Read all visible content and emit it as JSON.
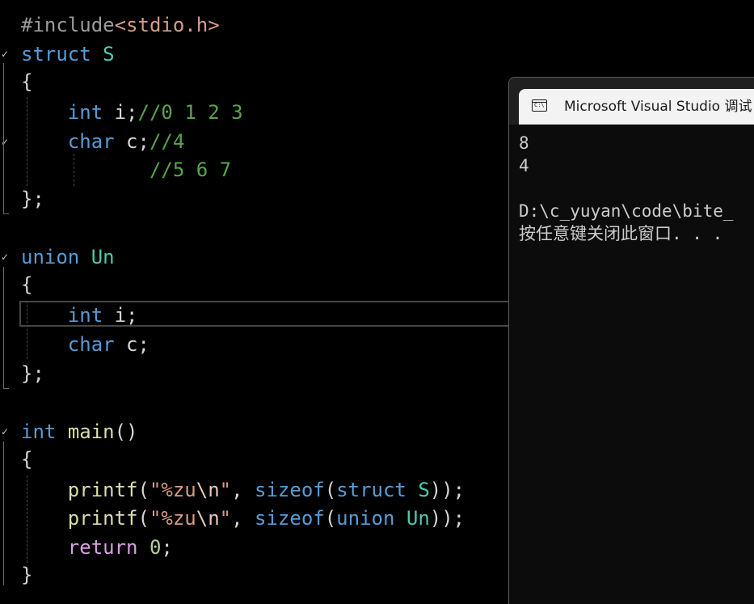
{
  "editor": {
    "lines": [
      {
        "parts": [
          [
            "pp",
            "#include"
          ],
          [
            "hd",
            "<stdio.h>"
          ]
        ]
      },
      {
        "parts": [
          [
            "kw",
            "struct"
          ],
          [
            "pu",
            " "
          ],
          [
            "ty",
            "S"
          ]
        ]
      },
      {
        "parts": [
          [
            "pu",
            "{"
          ]
        ]
      },
      {
        "parts": [
          [
            "ind",
            "    "
          ],
          [
            "kw",
            "int"
          ],
          [
            "pu",
            " i;"
          ],
          [
            "cm",
            "//0 1 2 3"
          ]
        ]
      },
      {
        "parts": [
          [
            "ind",
            "    "
          ],
          [
            "kw",
            "char"
          ],
          [
            "pu",
            " c;"
          ],
          [
            "cm",
            "//4"
          ]
        ]
      },
      {
        "parts": [
          [
            "ind",
            "           "
          ],
          [
            "cm",
            "//5 6 7"
          ]
        ]
      },
      {
        "parts": [
          [
            "pu",
            "};"
          ]
        ]
      },
      {
        "parts": []
      },
      {
        "parts": [
          [
            "kw",
            "union"
          ],
          [
            "pu",
            " "
          ],
          [
            "ty",
            "Un"
          ]
        ]
      },
      {
        "parts": [
          [
            "pu",
            "{"
          ]
        ]
      },
      {
        "parts": [
          [
            "ind",
            "    "
          ],
          [
            "kw",
            "int"
          ],
          [
            "pu",
            " i;"
          ]
        ]
      },
      {
        "parts": [
          [
            "ind",
            "    "
          ],
          [
            "kw",
            "char"
          ],
          [
            "pu",
            " c;"
          ]
        ]
      },
      {
        "parts": [
          [
            "pu",
            "};"
          ]
        ]
      },
      {
        "parts": []
      },
      {
        "parts": [
          [
            "kw",
            "int"
          ],
          [
            "pu",
            " "
          ],
          [
            "fn",
            "main"
          ],
          [
            "pu",
            "()"
          ]
        ]
      },
      {
        "parts": [
          [
            "pu",
            "{"
          ]
        ]
      },
      {
        "parts": [
          [
            "ind",
            "    "
          ],
          [
            "fn",
            "printf"
          ],
          [
            "pu",
            "("
          ],
          [
            "st",
            "\"%zu"
          ],
          [
            "es",
            "\\n"
          ],
          [
            "st",
            "\""
          ],
          [
            "pu",
            ", "
          ],
          [
            "kw",
            "sizeof"
          ],
          [
            "pu",
            "("
          ],
          [
            "kw",
            "struct"
          ],
          [
            "pu",
            " "
          ],
          [
            "ty",
            "S"
          ],
          [
            "pu",
            "));"
          ]
        ]
      },
      {
        "parts": [
          [
            "ind",
            "    "
          ],
          [
            "fn",
            "printf"
          ],
          [
            "pu",
            "("
          ],
          [
            "st",
            "\"%zu"
          ],
          [
            "es",
            "\\n"
          ],
          [
            "st",
            "\""
          ],
          [
            "pu",
            ", "
          ],
          [
            "kw",
            "sizeof"
          ],
          [
            "pu",
            "("
          ],
          [
            "kw",
            "union"
          ],
          [
            "pu",
            " "
          ],
          [
            "ty",
            "Un"
          ],
          [
            "pu",
            "));"
          ]
        ]
      },
      {
        "parts": [
          [
            "ind",
            "    "
          ],
          [
            "rt",
            "return"
          ],
          [
            "pu",
            " "
          ],
          [
            "nu",
            "0"
          ],
          [
            "pu",
            ";"
          ]
        ]
      },
      {
        "parts": [
          [
            "pu",
            "}"
          ]
        ]
      }
    ],
    "colors": {
      "keyword": "#569cd6",
      "type": "#4ec9b0",
      "function": "#dcdcaa",
      "string": "#d69d85",
      "comment": "#57a64a",
      "number": "#b5cea8",
      "return": "#d8a0df",
      "preprocessor": "#9b9b9b",
      "background": "#000000"
    }
  },
  "console": {
    "icon": "terminal-icon",
    "title": "Microsoft Visual Studio 调试",
    "output": [
      "8",
      "4",
      "",
      "D:\\c_yuyan\\code\\bite_",
      "按任意键关闭此窗口. . ."
    ]
  }
}
